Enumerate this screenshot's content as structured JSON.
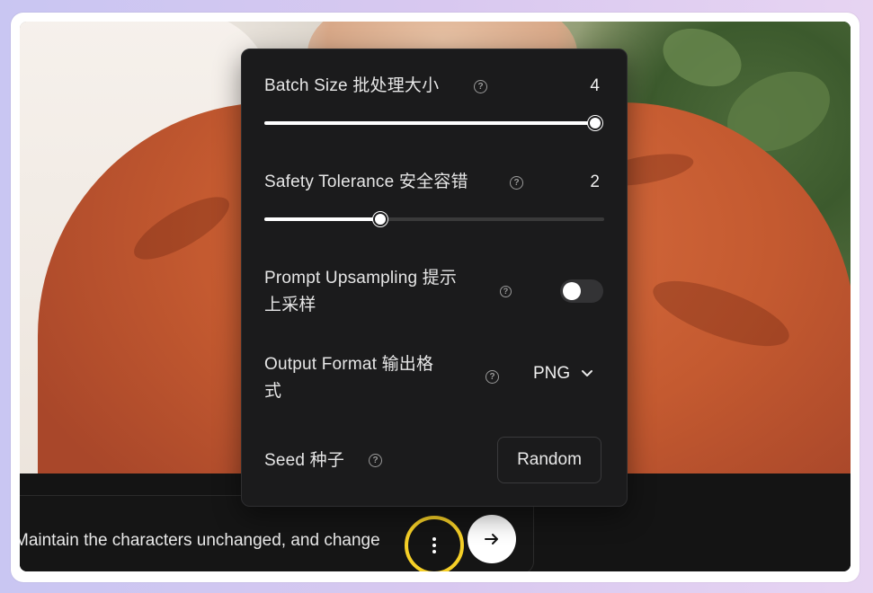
{
  "prompt": {
    "text": "Maintain the characters unchanged, and change"
  },
  "settings": {
    "batch_size": {
      "label": "Batch Size  批处理大小",
      "value": "4",
      "fraction": 1.0
    },
    "safety_tolerance": {
      "label": "Safety Tolerance  安全容错",
      "value": "2",
      "fraction": 0.34
    },
    "prompt_upsampling": {
      "label_line1": "Prompt Upsampling  提示",
      "label_line2": "上采样",
      "enabled": false
    },
    "output_format": {
      "label_line1": "Output Format  输出格",
      "label_line2": "式",
      "value": "PNG"
    },
    "seed": {
      "label": "Seed  种子",
      "button": "Random"
    }
  },
  "icons": {
    "help": "question-circle-icon",
    "more": "vertical-dots-icon",
    "send": "arrow-right-icon",
    "dropdown": "chevron-down-icon"
  },
  "colors": {
    "panel_bg": "#1b1b1c",
    "highlight_ring": "#f6d027"
  }
}
